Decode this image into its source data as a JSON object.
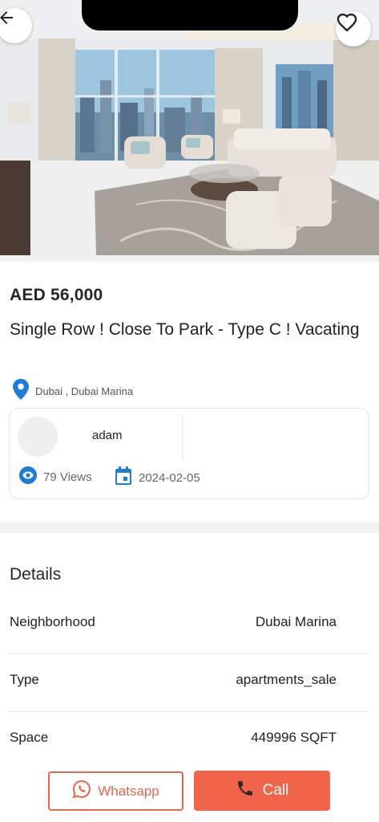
{
  "listing": {
    "price": "AED 56,000",
    "title": "Single Row ! Close To Park - Type C ! Vacating",
    "location": "Dubai , Dubai Marina"
  },
  "agent": {
    "name": "adam",
    "views": "79 Views",
    "date": "2024-02-05"
  },
  "details": {
    "heading": "Details",
    "rows": [
      {
        "key": "Neighborhood",
        "value": "Dubai Marina"
      },
      {
        "key": "Type",
        "value": "apartments_sale"
      },
      {
        "key": "Space",
        "value": "449996 SQFT"
      }
    ]
  },
  "actions": {
    "whatsapp_label": "Whatsapp",
    "call_label": "Call"
  },
  "icons": {
    "back": "arrow-left-icon",
    "favorite": "heart-icon",
    "location": "map-pin-icon",
    "views": "eye-icon",
    "date": "calendar-icon",
    "whatsapp": "whatsapp-icon",
    "call": "phone-icon"
  },
  "colors": {
    "accent": "#f0654a",
    "pin": "#1e7bd6"
  }
}
